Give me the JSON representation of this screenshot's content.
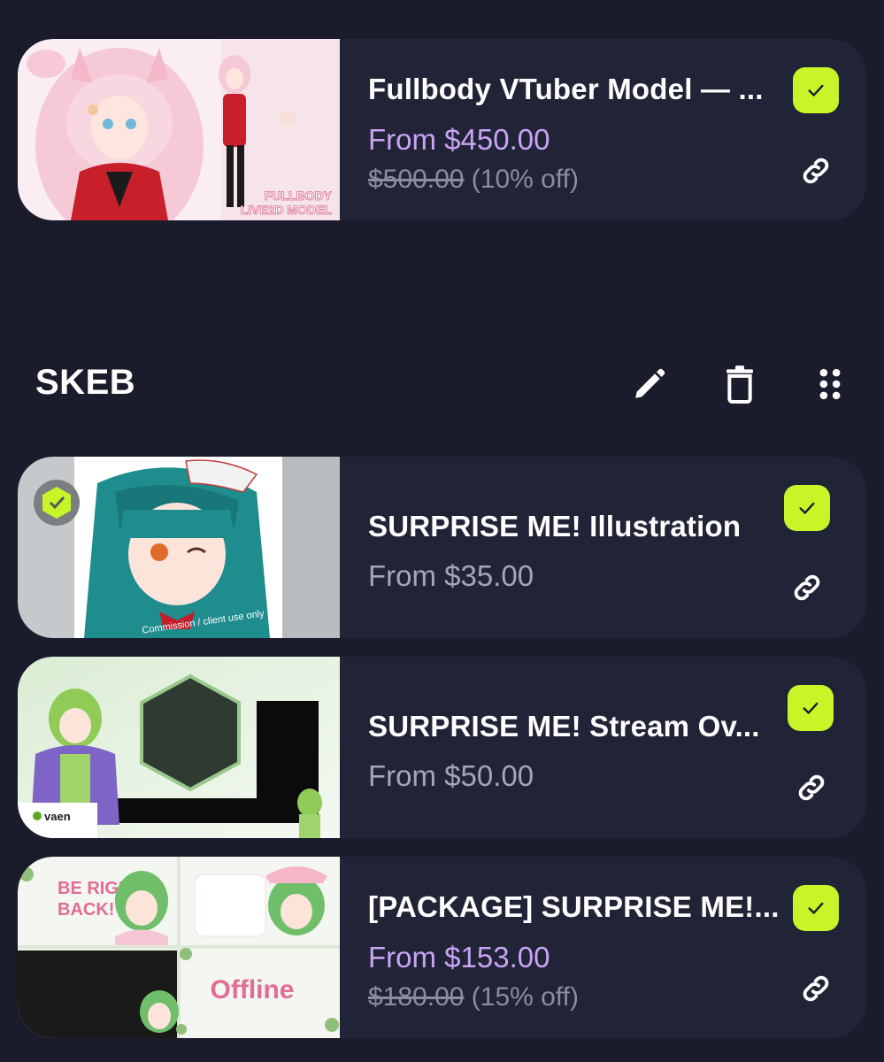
{
  "colors": {
    "background": "#1a1c2c",
    "card": "#212337",
    "accent_check": "#c8f528",
    "discount_price": "#c9a4f4",
    "muted": "#a4a6b8"
  },
  "cards_top": [
    {
      "title": "Fullbody VTuber Model — ...",
      "price": "From $450.00",
      "old_price": "$500.00",
      "discount": "(10% off)",
      "thumb_text_1": "FULLBODY",
      "thumb_text_2": "LIVE2D MODEL",
      "selected": true,
      "check_icon": "check-icon",
      "link_icon": "link-icon"
    }
  ],
  "section": {
    "title": "SKEB",
    "edit_icon": "pencil-icon",
    "delete_icon": "trash-icon",
    "drag_icon": "drag-handle-icon"
  },
  "cards": [
    {
      "title": "SURPRISE ME! Illustration",
      "price": "From $35.00",
      "thumb_caption": "Commission / client use only",
      "selected": true
    },
    {
      "title": "SURPRISE ME! Stream Ov...",
      "price": "From $50.00",
      "thumb_logo": "vaen",
      "selected": true
    },
    {
      "title": "[PACKAGE] SURPRISE ME!...",
      "price": "From $153.00",
      "old_price": "$180.00",
      "discount": "(15% off)",
      "thumb_text_1": "BE RIGHT",
      "thumb_text_2": "BACK!",
      "thumb_text_3": "Offline",
      "selected": true
    }
  ]
}
